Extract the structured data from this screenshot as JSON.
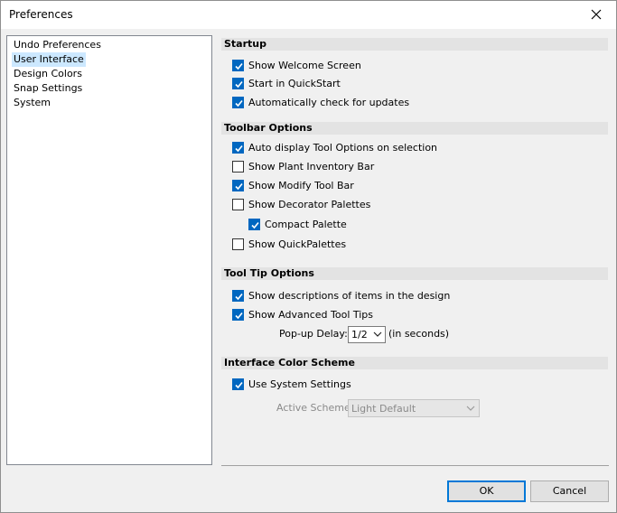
{
  "window": {
    "title": "Preferences"
  },
  "nav": {
    "items": [
      {
        "label": "Undo Preferences"
      },
      {
        "label": "User Interface"
      },
      {
        "label": "Design Colors"
      },
      {
        "label": "Snap Settings"
      },
      {
        "label": "System"
      }
    ]
  },
  "startup": {
    "header": "Startup",
    "show_welcome": "Show Welcome Screen",
    "start_quickstart": "Start in QuickStart",
    "auto_check_updates": "Automatically check for updates"
  },
  "toolbar": {
    "header": "Toolbar Options",
    "auto_display": "Auto display Tool Options on selection",
    "plant_inventory": "Show Plant Inventory Bar",
    "modify_toolbar": "Show Modify Tool Bar",
    "decorator_palettes": "Show Decorator Palettes",
    "compact_palette": "Compact Palette",
    "quickpalettes": "Show QuickPalettes"
  },
  "tooltip": {
    "header": "Tool Tip Options",
    "show_descriptions": "Show descriptions of items in the design",
    "advanced_tips": "Show Advanced Tool Tips",
    "popup_delay_label": "Pop-up Delay:",
    "popup_delay_value": "1/2",
    "popup_delay_unit": "(in seconds)"
  },
  "color_scheme": {
    "header": "Interface Color Scheme",
    "use_system": "Use System Settings",
    "active_scheme_label": "Active Scheme:",
    "active_scheme_value": "Light Default"
  },
  "buttons": {
    "ok": "OK",
    "cancel": "Cancel"
  },
  "colors": {
    "accent": "#0067c0",
    "selection": "#cce8ff",
    "section_bg": "#e3e3e3"
  }
}
